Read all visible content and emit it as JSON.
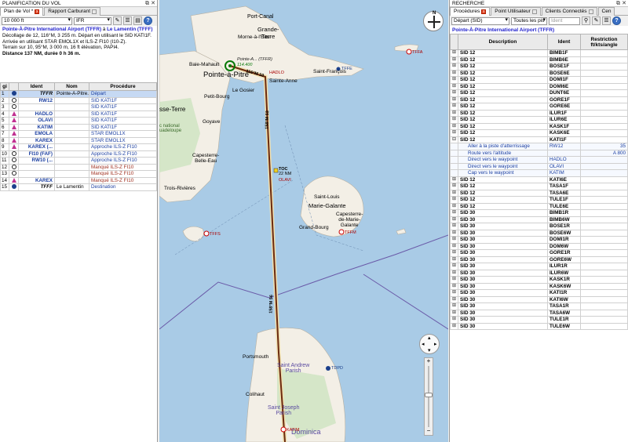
{
  "left": {
    "panel_title": "PLANIFICATION DU VOL",
    "tabs": [
      "Plan de Vol *",
      "Rapport Carburant"
    ],
    "altitude": "10 000 ft",
    "flight_rules": "IFR",
    "info": {
      "dep_name": "Pointe-À-Pitre International Airport (TFFR)",
      "to": "à",
      "arr_name": "Le Lamentin (TFFF)",
      "line2": "Décollage de 12, 116°M, 3 255 m. Départ en utilisant le SID KATI1F.",
      "line3": "Arrivée en utilisant STAR EMOL1X et ILS-Z FI10 (I10-Z).",
      "line4": "Terrain sur 10, 95°M, 3 000 m, 16 ft élévation, PAPI4.",
      "line5": "Distance 137 NM, durée 0 h 36 m."
    },
    "columns": [
      "gi",
      "Ident",
      "Nom",
      "Procédure"
    ],
    "rows": [
      {
        "n": "1",
        "sym": "apt",
        "ident": "TFFR",
        "nom": "Pointe-À-Pitre...",
        "proc": "Départ"
      },
      {
        "n": "2",
        "sym": "vor",
        "ident": "RW12",
        "nom": "",
        "proc": "SID KATI1F"
      },
      {
        "n": "3",
        "sym": "vor",
        "ident": "",
        "nom": "",
        "proc": "SID KATI1F"
      },
      {
        "n": "4",
        "sym": "tri",
        "ident": "HADLO",
        "nom": "",
        "proc": "SID KATI1F"
      },
      {
        "n": "5",
        "sym": "tri",
        "ident": "OLAVI",
        "nom": "",
        "proc": "SID KATI1F"
      },
      {
        "n": "6",
        "sym": "tri",
        "ident": "KATIM",
        "nom": "",
        "proc": "SID KATI1F"
      },
      {
        "n": "7",
        "sym": "tri",
        "ident": "EMOLA",
        "nom": "",
        "proc": "STAR EMOL1X"
      },
      {
        "n": "8",
        "sym": "tri",
        "ident": "KAREX",
        "nom": "",
        "proc": "STAR EMOL1X"
      },
      {
        "n": "9",
        "sym": "tri",
        "ident": "KAREX (...",
        "nom": "",
        "proc": "Approche ILS-Z FI10"
      },
      {
        "n": "10",
        "sym": "vor",
        "ident": "FI10 (FAF)",
        "nom": "",
        "proc": "Approche ILS-Z FI10"
      },
      {
        "n": "11",
        "sym": "vor",
        "ident": "RW10 (...",
        "nom": "",
        "proc": "Approche ILS-Z FI10"
      },
      {
        "n": "12",
        "sym": "vor",
        "ident": "",
        "nom": "",
        "proc": "Manqué ILS-Z FI10"
      },
      {
        "n": "13",
        "sym": "vor",
        "ident": "",
        "nom": "",
        "proc": "Manqué ILS-Z FI10"
      },
      {
        "n": "14",
        "sym": "tri",
        "ident": "KAREX",
        "nom": "",
        "proc": "Manqué ILS-Z FI10"
      },
      {
        "n": "15",
        "sym": "apt",
        "ident": "TFFF",
        "nom": "Le Lamentin",
        "proc": "Destination"
      }
    ]
  },
  "map": {
    "labels": {
      "port_canal": "Port-Canal",
      "grande_terre": "Grande-\nTerre",
      "morne": "Morne-à-l'Eau",
      "baie": "Baie-Mahault",
      "pap": "Pointe-à-Pitre",
      "sainte_anne": "Sainte-Anne",
      "le_gosier": "Le Gosier",
      "st_francois": "Saint-François",
      "petit_bourg": "Petit-Bourg",
      "basse_terre_isl": "sse-Terre",
      "goyave": "Goyave",
      "capesterre": "Capesterre-\nBelle-Eau",
      "parc": "c national\nuadeloupe",
      "trois_rivieres": "Trois-Rivières",
      "saint_louis": "Saint-Louis",
      "marie_galante": "Marie-Galante",
      "cap_mg": "Capesterre-\nde-Marie-\nGalante",
      "grand_bourg": "Grand-Bourg",
      "portsmouth": "Portsmouth",
      "st_andrew": "Saint Andrew\nParish",
      "colihaut": "Colihaut",
      "st_joseph": "Saint Joseph\nParish",
      "dominica": "Dominica",
      "toc": "TOC",
      "toc_dist": "22 NM",
      "olavi": "OLAVI",
      "hadlo": "HADLO",
      "tffa": "TFFA",
      "tffs": "TFFS",
      "tffm": "TFFM",
      "tdpd": "TDPD",
      "katim": "KATIM",
      "tffr_tag": "Pointe-A... (TFFR)",
      "tffr_freq": "114.400",
      "tffe": "TFFE",
      "leg1": "116°M 10",
      "leg2": "158°M 53",
      "leg3": "158°M 56"
    },
    "compass_n": "N"
  },
  "right": {
    "panel_title": "RECHERCHE",
    "tabs": [
      "Procédures",
      "Point Utilisateur",
      "Clients Connectés",
      "Cen"
    ],
    "filter1": "Départ (SID)",
    "filter2": "Toutes les pis",
    "filter3": "Ident",
    "airport_title": "Pointe-À-Pitre International Airport (TFFR)",
    "columns": [
      "Description",
      "Ident",
      "Restriction\nft/kts/angle"
    ],
    "rows_top": [
      {
        "d": "SID 12",
        "i": "BIMB1F"
      },
      {
        "d": "SID 12",
        "i": "BIMB6E"
      },
      {
        "d": "SID 12",
        "i": "BOSE1F"
      },
      {
        "d": "SID 12",
        "i": "BOSE6E"
      },
      {
        "d": "SID 12",
        "i": "DOMI1F"
      },
      {
        "d": "SID 12",
        "i": "DOMI6E"
      },
      {
        "d": "SID 12",
        "i": "DUNT6E"
      },
      {
        "d": "SID 12",
        "i": "GORE1F"
      },
      {
        "d": "SID 12",
        "i": "GORE6E"
      },
      {
        "d": "SID 12",
        "i": "ILUR1F"
      },
      {
        "d": "SID 12",
        "i": "ILUR6E"
      },
      {
        "d": "SID 12",
        "i": "KASK1F"
      },
      {
        "d": "SID 12",
        "i": "KASK6E"
      },
      {
        "d": "SID 12",
        "i": "KATI1F"
      }
    ],
    "rows_sub": [
      {
        "d": "Aller à la piste d'atterrissage",
        "i": "RW12",
        "r": "35"
      },
      {
        "d": "Route vers l'altitude",
        "i": "",
        "r": "A 800"
      },
      {
        "d": "Direct vers le waypoint",
        "i": "HADLO",
        "r": ""
      },
      {
        "d": "Direct vers le waypoint",
        "i": "OLAVI",
        "r": ""
      },
      {
        "d": "Cap vers le waypoint",
        "i": "KATIM",
        "r": ""
      }
    ],
    "rows_bottom": [
      {
        "d": "SID 12",
        "i": "KATI6E"
      },
      {
        "d": "SID 12",
        "i": "TASA1F"
      },
      {
        "d": "SID 12",
        "i": "TASA6E"
      },
      {
        "d": "SID 12",
        "i": "TULE1F"
      },
      {
        "d": "SID 12",
        "i": "TULE6E"
      },
      {
        "d": "SID 30",
        "i": "BIMB1R"
      },
      {
        "d": "SID 30",
        "i": "BIMB6W"
      },
      {
        "d": "SID 30",
        "i": "BOSE1R"
      },
      {
        "d": "SID 30",
        "i": "BOSE6W"
      },
      {
        "d": "SID 30",
        "i": "DOMI1R"
      },
      {
        "d": "SID 30",
        "i": "DOM6W"
      },
      {
        "d": "SID 30",
        "i": "GORE1R"
      },
      {
        "d": "SID 30",
        "i": "GORE6W"
      },
      {
        "d": "SID 30",
        "i": "ILUR1R"
      },
      {
        "d": "SID 30",
        "i": "ILUR6W"
      },
      {
        "d": "SID 30",
        "i": "KASK1R"
      },
      {
        "d": "SID 30",
        "i": "KASK6W"
      },
      {
        "d": "SID 30",
        "i": "KATI1R"
      },
      {
        "d": "SID 30",
        "i": "KATI6W"
      },
      {
        "d": "SID 30",
        "i": "TASA1R"
      },
      {
        "d": "SID 30",
        "i": "TASA6W"
      },
      {
        "d": "SID 30",
        "i": "TULE1R"
      },
      {
        "d": "SID 30",
        "i": "TULE6W"
      }
    ]
  }
}
